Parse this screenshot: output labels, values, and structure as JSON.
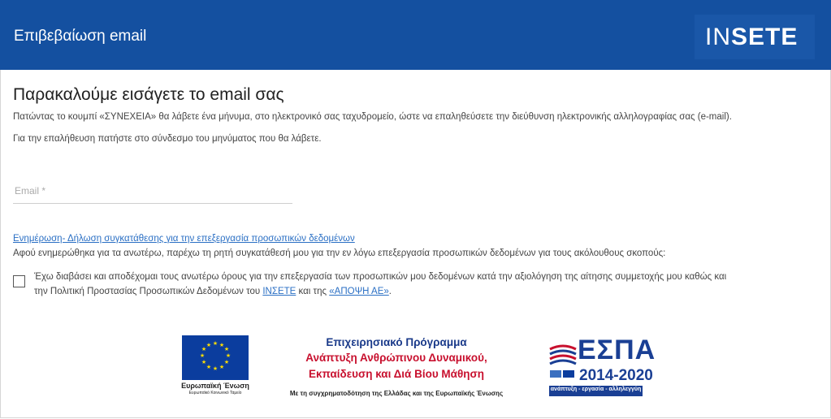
{
  "header": {
    "title": "Επιβεβαίωση email",
    "logo": {
      "light": "IN",
      "bold": "SETE"
    }
  },
  "main": {
    "heading": "Παρακαλούμε εισάγετε το email σας",
    "instruction": "Πατώντας το κουμπί «ΣΥΝΕΧΕΙΑ» θα λάβετε ένα μήνυμα, στο ηλεκτρονικό σας ταχυδρομείο, ώστε να επαληθεύσετε την διεύθυνση ηλεκτρονικής αλληλογραφίας σας (e-mail).",
    "verify_note": "Για την επαλήθευση πατήστε στο σύνδεσμο του μηνύματος που θα λάβετε.",
    "email": {
      "placeholder": "Email *",
      "value": ""
    },
    "consent_link": "Ενημέρωση- Δήλωση συγκατάθεσης για την επεξεργασία προσωπικών δεδομένων",
    "consent_intro": "Αφού ενημερώθηκα για τα ανωτέρω, παρέχω τη ρητή συγκατάθεσή μου για την εν λόγω επεξεργασία προσωπικών δεδομένων για τους ακόλουθους σκοπούς:",
    "checkbox": {
      "checked": false,
      "text_line1": "Έχω διαβάσει και αποδέχομαι τους ανωτέρω όρους για την επεξεργασία των προσωπικών μου δεδομένων κατά την αξιολόγηση της αίτησης συμμετοχής μου καθώς και",
      "text_line2_pre": "την Πολιτική Προστασίας Προσωπικών Δεδομένων του",
      "link1": "ΙΝΣΕΤΕ",
      "text_mid": "και της",
      "link2": "«ΑΠΟΨΗ ΑΕ»",
      "text_end": "."
    }
  },
  "footer": {
    "eu": {
      "name": "Ευρωπαϊκή Ένωση",
      "fund": "Ευρωπαϊκό Κοινωνικό Ταμείο",
      "flag_color": "#0b3d9e",
      "star_color": "#ffdd00"
    },
    "programme": {
      "title": "Επιχειρησιακό Πρόγραμμα",
      "line1": "Ανάπτυξη Ανθρώπινου Δυναμικού,",
      "line2": "Εκπαίδευση και Διά Βίου Μάθηση",
      "funding": "Με τη συγχρηματοδότηση της Ελλάδας και της Ευρωπαϊκής Ένωσης"
    },
    "espa": {
      "word": "ΕΣΠΑ",
      "years": "2014-2020",
      "tagline": "ανάπτυξη - εργασία - αλληλεγγύη"
    }
  },
  "colors": {
    "header_bg": "#1450a0",
    "link": "#2a6fc4",
    "programme_red": "#c8102e",
    "programme_blue": "#1a3a8a"
  }
}
